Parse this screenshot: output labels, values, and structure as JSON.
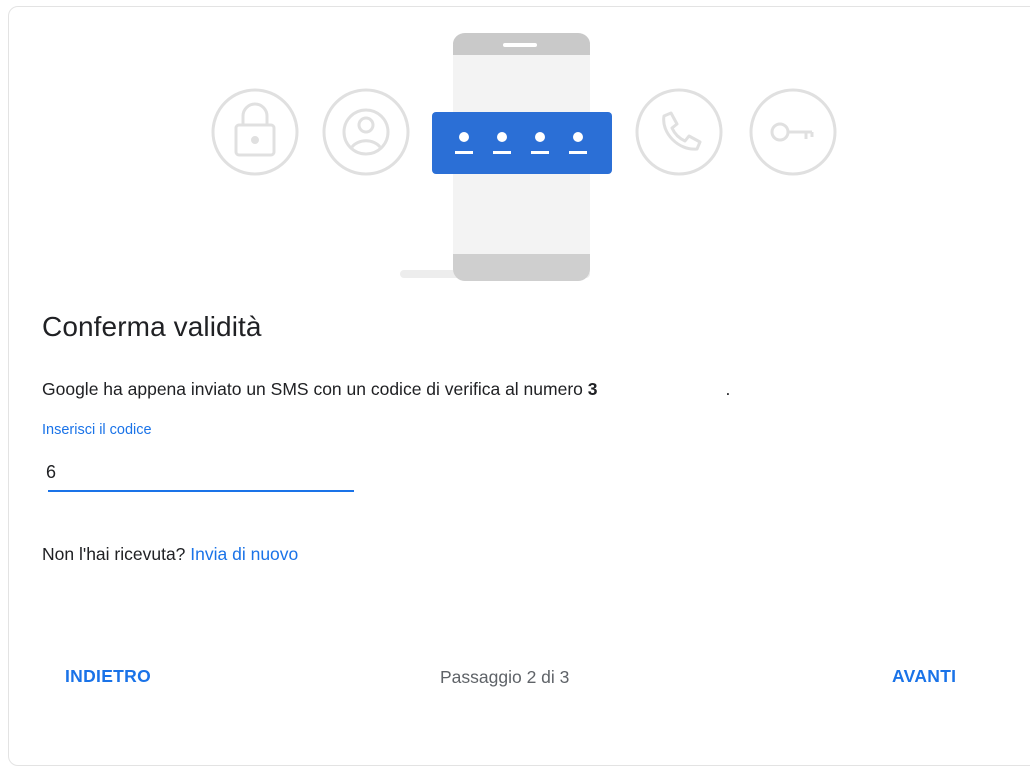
{
  "page": {
    "title": "Conferma validità",
    "description_prefix": "Google ha appena inviato un SMS con un codice di verifica al numero ",
    "phone_number": "3",
    "description_suffix": "."
  },
  "code_field": {
    "label": "Inserisci il codice",
    "value": "6"
  },
  "resend": {
    "prompt": "Non l'hai ricevuta? ",
    "link_label": "Invia di nuovo"
  },
  "footer": {
    "back_label": "INDIETRO",
    "step_text": "Passaggio 2 di 3",
    "next_label": "AVANTI"
  },
  "illustration": {
    "icons": [
      "lock-icon",
      "person-icon",
      "code-dots-icon",
      "phone-icon",
      "key-icon"
    ],
    "code_dots": 4
  },
  "colors": {
    "accent": "#1a73e8",
    "code_card": "#2b6fd6",
    "circle_stroke": "#e4e4e4",
    "phone_body": "#ececec",
    "text_primary": "#202124",
    "text_secondary": "#5f6368"
  }
}
